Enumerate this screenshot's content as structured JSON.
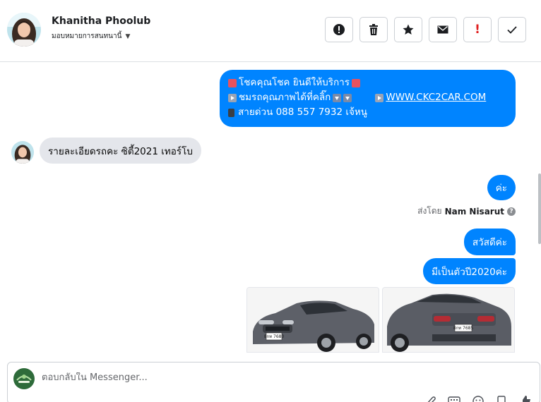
{
  "header": {
    "contact_name": "Khanitha Phoolub",
    "assign_label": "มอบหมายการสนทนานี้",
    "actions": [
      "exclamation-circle-icon",
      "trash-icon",
      "star-icon",
      "envelope-icon",
      "red-exclamation-icon",
      "check-icon"
    ],
    "red_action_label": "!"
  },
  "messages": {
    "promo": {
      "line1": "โชคคุณโชค ยินดีให้บริการ",
      "line2": "ชมรถคุณภาพได้ที่คลิ๊ก",
      "link": "WWW.CKC2CAR.COM",
      "line3": "สายด่วน 088 557 7932 เจ้หนู"
    },
    "incoming_1": "รายละเอียดรถคะ ซิตี้2021 เทอร์โบ",
    "outgoing_1": "ค่ะ",
    "sent_by_prefix": "ส่งโดย",
    "sent_by_name": "Nam Nisarut",
    "help_mark": "?",
    "outgoing_2": "สวัสดีค่ะ",
    "outgoing_3": "มีเป็นตัวปี2020ค่ะ",
    "photos": [
      {
        "plate": "8กท 7680"
      },
      {
        "plate": "8กท 7685"
      }
    ]
  },
  "composer": {
    "placeholder": "ตอบกลับใน Messenger..."
  },
  "colors": {
    "accent": "#0084ff",
    "incoming_bubble": "#e4e6eb",
    "alert_red": "#e02020"
  }
}
